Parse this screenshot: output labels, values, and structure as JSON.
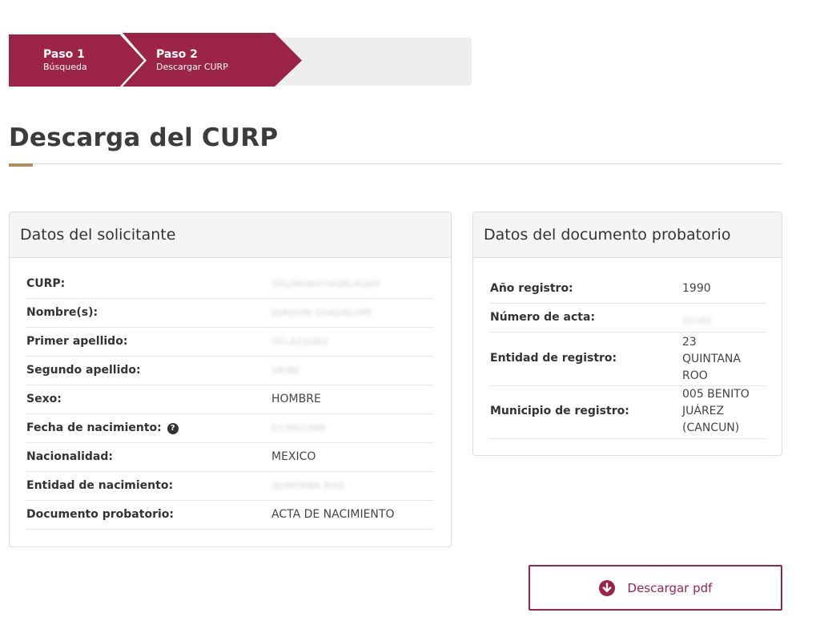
{
  "stepper": {
    "steps": [
      {
        "title": "Paso 1",
        "subtitle": "Búsqueda"
      },
      {
        "title": "Paso 2",
        "subtitle": "Descargar CURP"
      }
    ],
    "active_color": "#9d2449"
  },
  "page": {
    "title": "Descarga del CURP",
    "accent_color": "#b38e5d"
  },
  "applicant": {
    "header": "Datos del solicitante",
    "rows": [
      {
        "label": "CURP:",
        "value": "VELJ900607HQRLRQ09"
      },
      {
        "label": "Nombre(s):",
        "value": "JOAQUIN GUADALUPE"
      },
      {
        "label": "Primer apellido:",
        "value": "VELAZQUEZ"
      },
      {
        "label": "Segundo apellido:",
        "value": "URIBE"
      },
      {
        "label": "Sexo:",
        "value": "HOMBRE"
      },
      {
        "label": "Fecha de nacimiento:",
        "value": "07/06/1990"
      },
      {
        "label": "Nacionalidad:",
        "value": "MEXICO"
      },
      {
        "label": "Entidad de nacimiento:",
        "value": "QUINTANA ROO"
      },
      {
        "label": "Documento probatorio:",
        "value": "ACTA DE NACIMIENTO"
      }
    ]
  },
  "document": {
    "header": "Datos del documento probatorio",
    "rows": [
      {
        "label": "Año registro:",
        "value": "1990"
      },
      {
        "label": "Número de acta:",
        "value": "02165"
      },
      {
        "label": "Entidad de registro:",
        "value_lines": [
          "23",
          "QUINTANA",
          "ROO"
        ]
      },
      {
        "label": "Municipio de registro:",
        "value_lines": [
          "005 BENITO",
          "JUÁREZ",
          "(CANCUN)"
        ]
      }
    ]
  },
  "download": {
    "label": "Descargar pdf",
    "icon": "arrow-down-circle-icon"
  }
}
